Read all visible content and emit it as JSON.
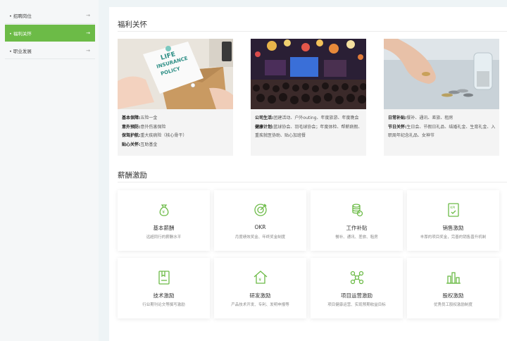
{
  "sidebar": {
    "items": [
      {
        "label": "招聘岗位",
        "arrow": "→"
      },
      {
        "label": "福利关怀",
        "arrow": "→"
      },
      {
        "label": "职业发展",
        "arrow": "→"
      }
    ]
  },
  "welfare": {
    "title": "福利关怀",
    "cards": [
      {
        "image_label": "LIFE INSURANCE POLICY",
        "lines": [
          {
            "k": "基本保障:",
            "v": "五险一金"
          },
          {
            "k": "意外预防:",
            "v": "意外伤害保险"
          },
          {
            "k": "保驾护航:",
            "v": "重大疾病险（核心骨干）"
          },
          {
            "k": "贴心关怀:",
            "v": "互助基金"
          }
        ]
      },
      {
        "lines": [
          {
            "k": "公司生活:",
            "v": "团建活动、户外outing、年度旅游、年度晚会"
          },
          {
            "k": "健康计划:",
            "v": "篮球协会、羽毛球协会；年度体检、帮薪病假、重疾就医协助、贴心加班餐"
          }
        ]
      },
      {
        "lines": [
          {
            "k": "日常补贴:",
            "v": "餐补、通讯、差旅、租房"
          },
          {
            "k": "节日关怀:",
            "v": "生日会、节假日礼品、结婚礼金、生育礼金、入职周年纪念礼品、女神节"
          }
        ]
      }
    ]
  },
  "incentive": {
    "title": "薪酬激励",
    "items": [
      {
        "title": "基本薪酬",
        "desc": "远超同行的薪酬水平",
        "icon": "money-bag-icon"
      },
      {
        "title": "OKR",
        "desc": "月度绩效奖金、年终奖金制度",
        "icon": "target-icon"
      },
      {
        "title": "工作补贴",
        "desc": "餐补、通讯、差旅、租房",
        "icon": "coins-icon"
      },
      {
        "title": "销售激励",
        "desc": "丰厚的项目奖金，完善的销售晋升机制",
        "icon": "kpi-icon"
      },
      {
        "title": "技术激励",
        "desc": "行业期刊论文等撰写激励",
        "icon": "book-icon"
      },
      {
        "title": "研发激励",
        "desc": "产品技术开发、专利、发明申报等",
        "icon": "house-yen-icon"
      },
      {
        "title": "项目运营激励",
        "desc": "项目健康运营、实现预期收益目标",
        "icon": "network-icon"
      },
      {
        "title": "股权激励",
        "desc": "优秀员工股权激励制度",
        "icon": "bar-chart-icon"
      }
    ]
  },
  "colors": {
    "accent": "#6cbb47",
    "icon": "#6cbb47"
  }
}
